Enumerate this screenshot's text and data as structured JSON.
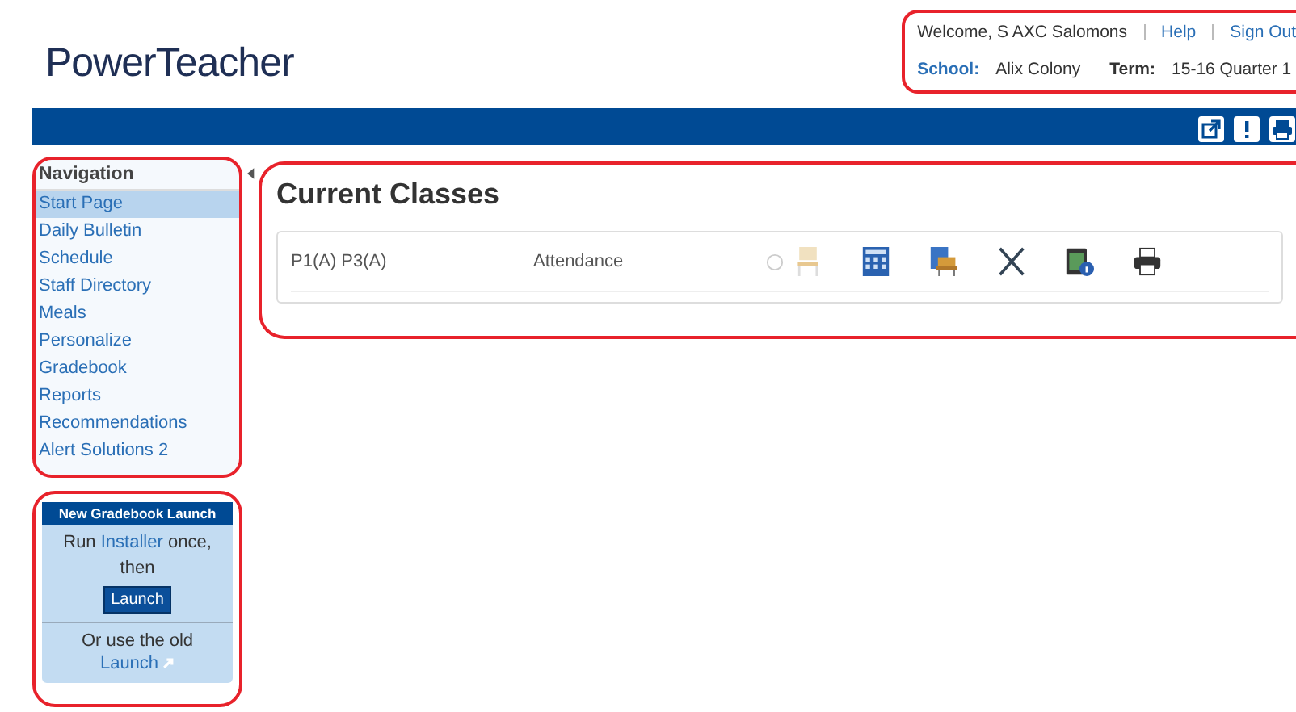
{
  "logo": "PowerTeacher",
  "header": {
    "welcome": "Welcome, S AXC Salomons",
    "links": [
      "Help",
      "Sign Out"
    ],
    "school_label": "School:",
    "school": "Alix Colony",
    "term_label": "Term:",
    "term": "15-16 Quarter 1"
  },
  "navigation": {
    "title": "Navigation",
    "items": [
      {
        "label": "Start Page",
        "selected": true
      },
      {
        "label": "Daily Bulletin",
        "selected": false
      },
      {
        "label": "Schedule",
        "selected": false
      },
      {
        "label": "Staff Directory",
        "selected": false
      },
      {
        "label": "Meals",
        "selected": false
      },
      {
        "label": "Personalize",
        "selected": false
      },
      {
        "label": "Gradebook",
        "selected": false
      },
      {
        "label": "Reports",
        "selected": false
      },
      {
        "label": "Recommendations",
        "selected": false
      },
      {
        "label": "Alert Solutions 2",
        "selected": false
      }
    ]
  },
  "launch_box": {
    "title": "New Gradebook Launch",
    "before": "Run",
    "link": "Installer",
    "after": "once, then",
    "button": "Launch",
    "old_text": "Or use the old",
    "old_link": "Launch"
  },
  "current_classes": {
    "title": "Current Classes",
    "rows": [
      {
        "periods": "P1(A) P3(A)",
        "course": "Attendance"
      }
    ]
  }
}
